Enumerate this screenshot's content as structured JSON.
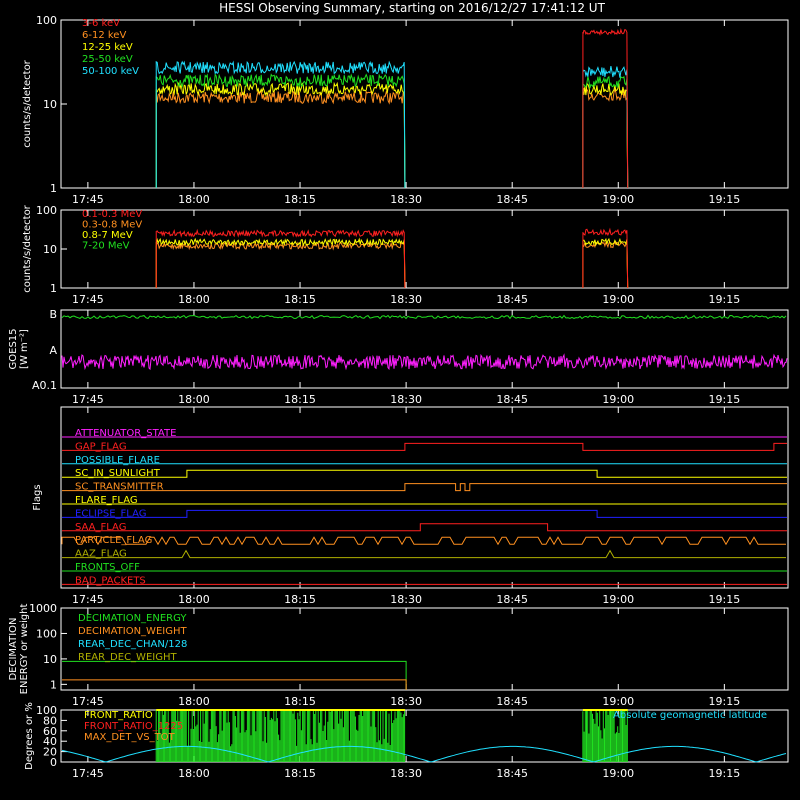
{
  "title": "HESSI Observing Summary, starting on 2016/12/27 17:41:12 UT",
  "time_ticks": [
    "17:45",
    "18:00",
    "18:15",
    "18:30",
    "18:45",
    "19:00",
    "19:15"
  ],
  "chart_data": [
    {
      "id": "low_energy",
      "type": "line",
      "ylabel": "counts/s/detector",
      "y_scale": "log",
      "ylim": [
        1,
        100
      ],
      "yticks": [
        "1",
        "10",
        "100"
      ],
      "x_unit": "UT time",
      "xlim": [
        "17:41:12",
        "19:24:00"
      ],
      "observation_windows": [
        [
          "17:54:40",
          "18:29:50"
        ],
        [
          "18:55:00",
          "19:01:20"
        ]
      ],
      "series": [
        {
          "name": "3-6 keV",
          "color": "#ff2020",
          "level_window1": null,
          "level_window2": 72
        },
        {
          "name": "6-12 keV",
          "color": "#ff9020",
          "level_window1": 12,
          "level_window2": 13
        },
        {
          "name": "12-25 keV",
          "color": "#ffff00",
          "level_window1": 15,
          "level_window2": 15
        },
        {
          "name": "25-50 keV",
          "color": "#20e020",
          "level_window1": 19,
          "level_window2": 18
        },
        {
          "name": "50-100 keV",
          "color": "#20e0ff",
          "level_window1": 27,
          "level_window2": 24
        }
      ]
    },
    {
      "id": "high_energy",
      "type": "line",
      "ylabel": "counts/s/detector",
      "y_scale": "log",
      "ylim": [
        1,
        100
      ],
      "yticks": [
        "1",
        "10",
        "100"
      ],
      "series": [
        {
          "name": "0.1-0.3 MeV",
          "color": "#ff2020",
          "level_window1": 25,
          "level_window2": 27
        },
        {
          "name": "0.3-0.8 MeV",
          "color": "#ff9020",
          "level_window1": 12,
          "level_window2": 13
        },
        {
          "name": "0.8-7 MeV",
          "color": "#ffff00",
          "level_window1": 15,
          "level_window2": 15
        },
        {
          "name": "7-20 MeV",
          "color": "#20e020",
          "level_window1": null,
          "level_window2": null
        }
      ]
    },
    {
      "id": "goes",
      "type": "line",
      "ylabel": "GOES15 [W m⁻²]",
      "ylabel_line1": "GOES15",
      "ylabel_line2": "[W m⁻²]",
      "yticks": [
        "A0.1",
        "A",
        "B"
      ],
      "series": [
        {
          "name": "long channel",
          "color": "#20e020",
          "level": "B"
        },
        {
          "name": "short channel",
          "color": "#ff20ff",
          "level": "A"
        }
      ]
    },
    {
      "id": "flags",
      "type": "step",
      "ylabel": "Flags",
      "flags": [
        {
          "name": "ATTENUATOR_STATE",
          "color": "#ff20ff",
          "transitions": []
        },
        {
          "name": "GAP_FLAG",
          "color": "#ff2020",
          "transitions": [
            "18:29:50",
            "18:55:00",
            "19:22:00"
          ]
        },
        {
          "name": "POSSIBLE_FLARE",
          "color": "#20e0ff",
          "transitions": []
        },
        {
          "name": "SC_IN_SUNLIGHT",
          "color": "#ffff00",
          "transitions": [
            "17:59:00",
            "18:57:00"
          ]
        },
        {
          "name": "SC_TRANSMITTER",
          "color": "#ff9020",
          "transitions": [
            "18:29:50",
            "18:37:00",
            "18:37:40",
            "18:38:20",
            "18:39:00"
          ]
        },
        {
          "name": "FLARE_FLAG",
          "color": "#ffff00",
          "transitions": []
        },
        {
          "name": "ECLIPSE_FLAG",
          "color": "#2020ff",
          "transitions": [
            "17:59:00",
            "18:57:00"
          ]
        },
        {
          "name": "SAA_FLAG",
          "color": "#ff2020",
          "transitions": [
            "18:32:00",
            "18:50:00"
          ]
        },
        {
          "name": "PARTICLE_FLAG",
          "color": "#ff9020",
          "transitions": []
        },
        {
          "name": "AAZ_FLAG",
          "color": "#b0b000",
          "transitions": []
        },
        {
          "name": "FRONTS_OFF",
          "color": "#20e020",
          "transitions": []
        },
        {
          "name": "BAD_PACKETS",
          "color": "#ff2020",
          "transitions": []
        }
      ]
    },
    {
      "id": "decimation",
      "type": "step",
      "ylabel": "DECIMATION ENERGY or weight",
      "ylabel_line1": "DECIMATION",
      "ylabel_line2": "ENERGY or weight",
      "y_scale": "log",
      "ylim": [
        0.6,
        1000
      ],
      "yticks": [
        "1",
        "10",
        "100",
        "1000"
      ],
      "series": [
        {
          "name": "DECIMATION_ENERGY",
          "color": "#20e020",
          "value_until_18:30": 8
        },
        {
          "name": "DECIMATION_WEIGHT",
          "color": "#ff9020",
          "value_until_18:30": 1.5
        },
        {
          "name": "REAR_DEC_CHAN/128",
          "color": "#20e0ff",
          "value_until_18:30": null
        },
        {
          "name": "REAR_DEC_WEIGHT",
          "color": "#b0b000",
          "value_until_18:30": null
        }
      ]
    },
    {
      "id": "ratios",
      "type": "line",
      "ylabel": "Degrees or %",
      "ylim": [
        0,
        100
      ],
      "yticks": [
        "0",
        "20",
        "40",
        "60",
        "80",
        "100"
      ],
      "series": [
        {
          "name": "FRONT_RATIO",
          "color": "#ffff00"
        },
        {
          "name": "FRONT_RATIO_1225",
          "color": "#ff2020"
        },
        {
          "name": "MAX_DET_VS_TOT",
          "color": "#ff9020"
        },
        {
          "name": "Absolute geomagnetic latitude",
          "color": "#20e0ff",
          "max_deg": 30,
          "min_deg": 0
        }
      ]
    }
  ]
}
